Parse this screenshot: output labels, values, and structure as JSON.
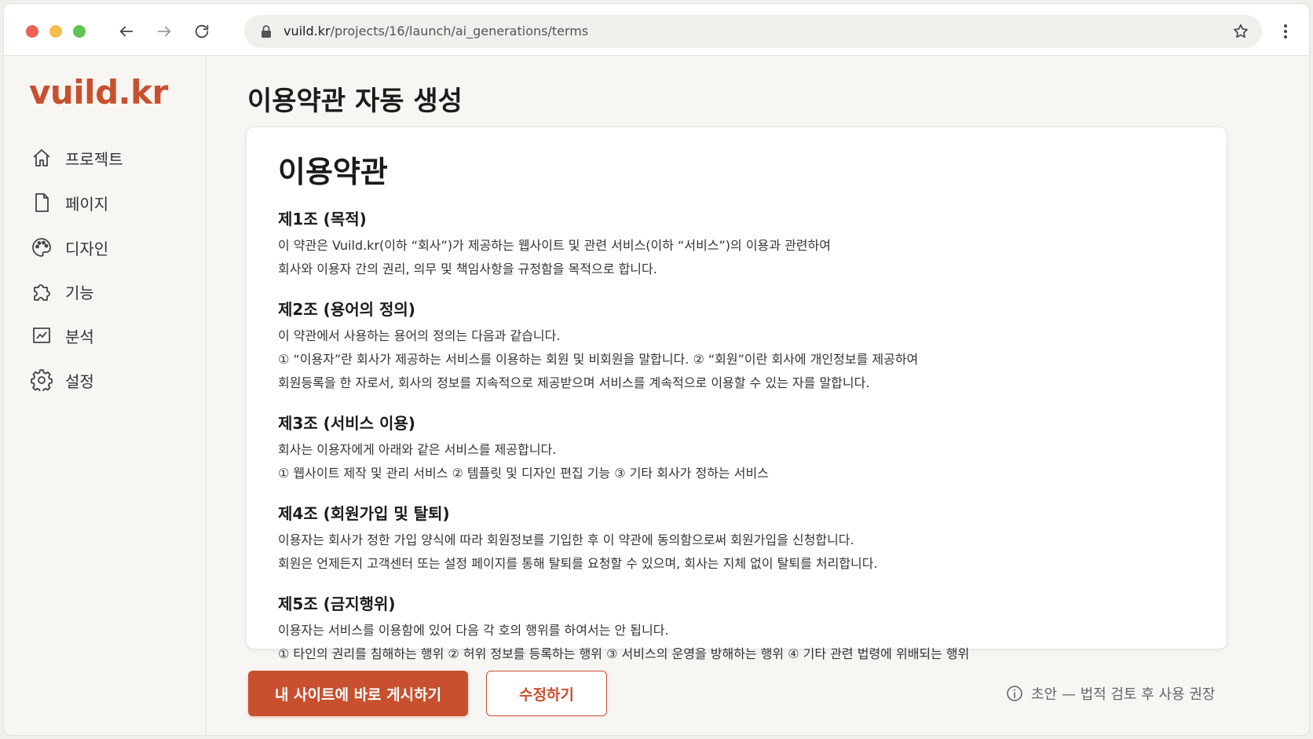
{
  "browser": {
    "url_host": "vuild.kr",
    "url_path": "/projects/16/launch/ai_generations/terms"
  },
  "sidebar": {
    "logo": "vuild.kr",
    "items": [
      {
        "label": "프로젝트",
        "icon": "home-icon"
      },
      {
        "label": "페이지",
        "icon": "file-icon"
      },
      {
        "label": "디자인",
        "icon": "palette-icon"
      },
      {
        "label": "기능",
        "icon": "puzzle-icon"
      },
      {
        "label": "분석",
        "icon": "chart-icon"
      },
      {
        "label": "설정",
        "icon": "gear-icon"
      }
    ]
  },
  "main": {
    "page_title": "이용약관 자동 생성",
    "document": {
      "title": "이용약관",
      "sections": [
        {
          "heading": "제1조 (목적)",
          "lines": [
            "이 약관은 Vuild.kr(이하 “회사”)가 제공하는 웹사이트 및 관련 서비스(이하 “서비스”)의 이용과 관련하여",
            "회사와 이용자 간의 권리, 의무 및 책임사항을 규정함을 목적으로 합니다."
          ]
        },
        {
          "heading": "제2조 (용어의 정의)",
          "lines": [
            "이 약관에서 사용하는 용어의 정의는 다음과 같습니다.",
            "① “이용자”란 회사가 제공하는 서비스를 이용하는 회원 및 비회원을 말합니다. ② “회원”이란 회사에 개인정보를 제공하여",
            "회원등록을 한 자로서, 회사의 정보를 지속적으로 제공받으며 서비스를 계속적으로 이용할 수 있는 자를 말합니다."
          ]
        },
        {
          "heading": "제3조 (서비스 이용)",
          "lines": [
            "회사는 이용자에게 아래와 같은 서비스를 제공합니다.",
            "① 웹사이트 제작 및 관리 서비스 ② 템플릿 및 디자인 편집 기능 ③ 기타 회사가 정하는 서비스"
          ]
        },
        {
          "heading": "제4조 (회원가입 및 탈퇴)",
          "lines": [
            "이용자는 회사가 정한 가입 양식에 따라 회원정보를 기입한 후 이 약관에 동의함으로써 회원가입을 신청합니다.",
            "회원은 언제든지 고객센터 또는 설정 페이지를 통해 탈퇴를 요청할 수 있으며, 회사는 지체 없이 탈퇴를 처리합니다."
          ]
        },
        {
          "heading": "제5조 (금지행위)",
          "lines": [
            "이용자는 서비스를 이용함에 있어 다음 각 호의 행위를 하여서는 안 됩니다.",
            "① 타인의 권리를 침해하는 행위 ② 허위 정보를 등록하는 행위 ③ 서비스의 운영을 방해하는 행위 ④ 기타 관련 법령에 위배되는 행위"
          ]
        }
      ]
    },
    "actions": {
      "publish_label": "내 사이트에 바로 게시하기",
      "edit_label": "수정하기",
      "notice": "초안 — 법적 검토 후 사용 권장"
    }
  },
  "colors": {
    "brand": "#c8502e",
    "background": "#f8f6f3"
  }
}
